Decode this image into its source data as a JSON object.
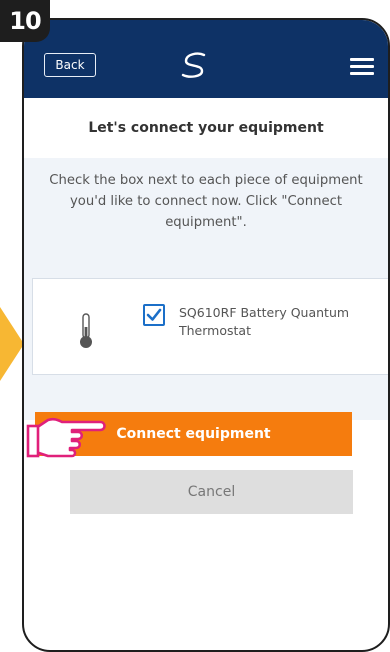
{
  "step_number": "10",
  "header": {
    "back_label": "Back",
    "logo_icon": "s-logo-icon",
    "menu_icon": "hamburger-menu-icon"
  },
  "page_title": "Let's connect your equipment",
  "instructions": "Check the box next to each piece of equipment you'd like to connect now. Click \"Connect equipment\".",
  "equipment": [
    {
      "name": "SQ610RF Battery Quantum Thermostat",
      "checked": true,
      "icon": "thermometer-icon"
    }
  ],
  "buttons": {
    "connect_label": "Connect equipment",
    "cancel_label": "Cancel"
  },
  "colors": {
    "header_bg": "#0e3266",
    "connect_button": "#f57c0e",
    "cancel_button": "#dedede",
    "checkbox": "#1b6fc8",
    "step_badge": "#1e1e1e",
    "side_arrow": "#f7b733",
    "pointer_hand": "#e0207a"
  }
}
